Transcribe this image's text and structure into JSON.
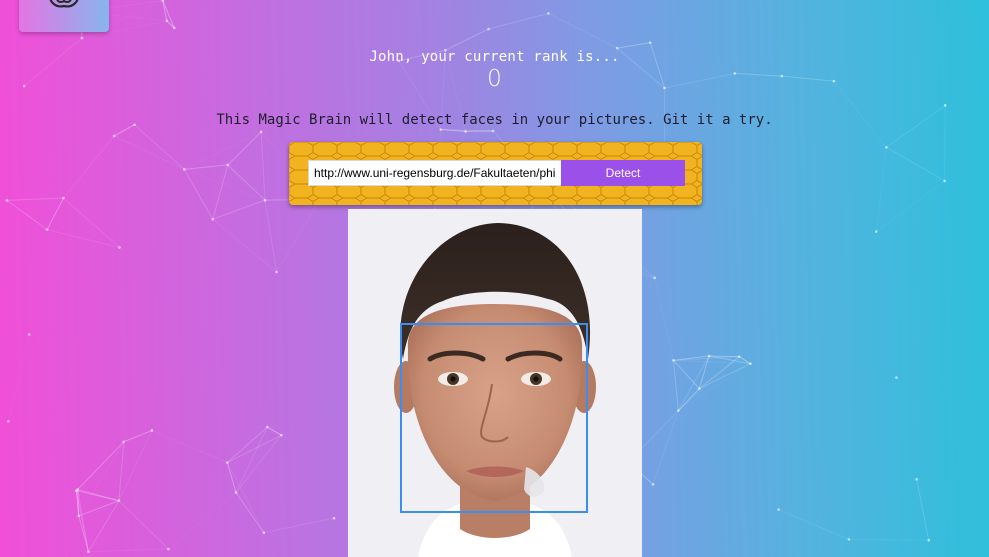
{
  "app": {
    "logo_icon": "brain-icon"
  },
  "rank": {
    "caption": "John, your current rank is...",
    "value": "0"
  },
  "description": "This Magic Brain will detect faces in your pictures. Git it a try.",
  "image_form": {
    "url_value": "http://www.uni-regensburg.de/Fakultaeten/phil_F",
    "detect_label": "Detect"
  },
  "result": {
    "image_subject": "face-photo",
    "faces_detected": 1
  },
  "colors": {
    "gradient_left": "#f14fd8",
    "gradient_right": "#2ec0dc",
    "panel_yellow": "#f1b320",
    "button_purple": "#9b50ea",
    "bounding_box_blue": "#3a8ef0"
  }
}
